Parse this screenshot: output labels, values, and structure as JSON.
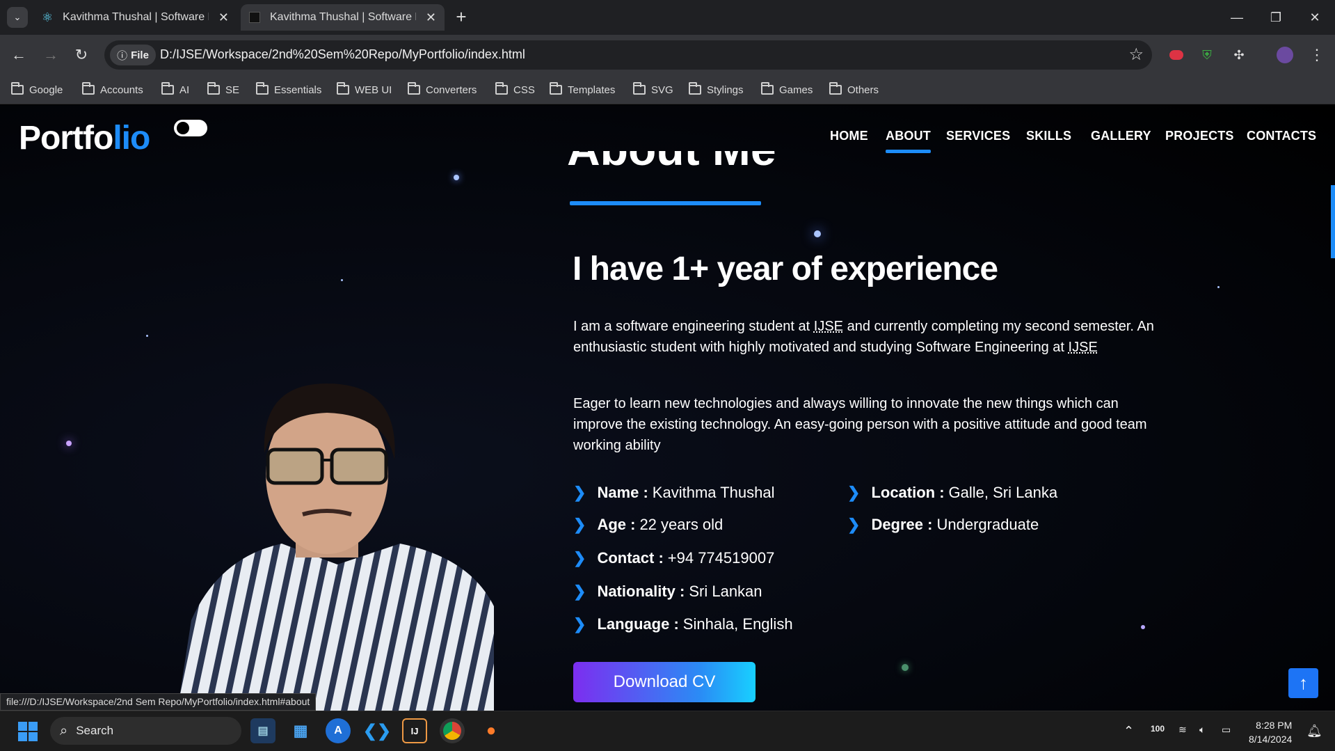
{
  "browser": {
    "tabs": [
      {
        "title": "Kavithma Thushal | Software En",
        "active": false
      },
      {
        "title": "Kavithma Thushal | Software En",
        "active": true
      }
    ],
    "url": "D:/IJSE/Workspace/2nd%20Sem%20Repo/MyPortfolio/index.html",
    "file_chip": "File",
    "bookmarks": [
      "Google",
      "Accounts",
      "AI",
      "SE",
      "Essentials",
      "WEB UI",
      "Converters",
      "CSS",
      "Templates",
      "SVG",
      "Stylings",
      "Games",
      "Others"
    ],
    "status_url": "file:///D:/IJSE/Workspace/2nd Sem Repo/MyPortfolio/index.html#about"
  },
  "site": {
    "logo_main": "Portfo",
    "logo_accent": "lio",
    "nav": [
      "HOME",
      "ABOUT",
      "SERVICES",
      "SKILLS",
      "GALLERY",
      "PROJECTS",
      "CONTACTS"
    ],
    "active_nav": "ABOUT",
    "section_title": "About Me",
    "heading": "I have 1+ year of experience",
    "para1_a": "I am a software engineering student at ",
    "para1_abbr1": "IJSE",
    "para1_b": " and currently completing my second semester. An enthusiastic student with highly motivated and studying Software Engineering at ",
    "para1_abbr2": "IJSE",
    "para2": "Eager to learn new technologies and always willing to innovate the new things which can improve the existing technology. An easy-going person with a positive attitude and good team working ability",
    "info_left": [
      {
        "label": "Name :",
        "value": "Kavithma Thushal"
      },
      {
        "label": "Age :",
        "value": "22 years old"
      },
      {
        "label": "Contact :",
        "value": "+94 774519007"
      },
      {
        "label": "Nationality :",
        "value": "Sri Lankan"
      },
      {
        "label": "Language :",
        "value": "Sinhala, English"
      }
    ],
    "info_right": [
      {
        "label": "Location :",
        "value": "Galle, Sri Lanka"
      },
      {
        "label": "Degree :",
        "value": "Undergraduate"
      }
    ],
    "download_button": "Download CV",
    "colors": {
      "accent": "#1d8cf8",
      "button_start": "#7c2ef0",
      "button_end": "#18d0ff"
    }
  },
  "taskbar": {
    "search_placeholder": "Search",
    "battery": "100",
    "time": "8:28 PM",
    "date": "8/14/2024"
  }
}
